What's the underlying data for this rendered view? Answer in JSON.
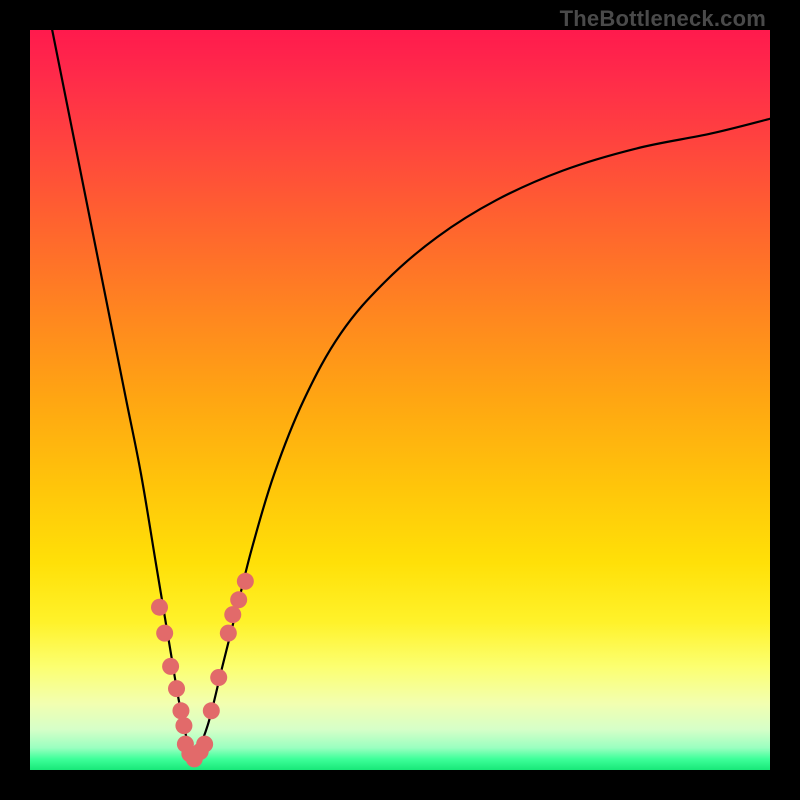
{
  "attribution": "TheBottleneck.com",
  "colors": {
    "frame": "#000000",
    "curve": "#000000",
    "marker": "#e26a6a",
    "gradient_top": "#ff1a4d",
    "gradient_mid": "#ffe008",
    "gradient_bottom": "#18e878"
  },
  "chart_data": {
    "type": "line",
    "title": "",
    "xlabel": "",
    "ylabel": "",
    "xlim": [
      0,
      100
    ],
    "ylim": [
      0,
      100
    ],
    "grid": false,
    "notes": "Bottleneck-style V-curve. x is an arbitrary component scale, y is percent bottleneck (0 = ideal, 100 = worst). Optimal point at x≈22. Values estimated from pixel positions.",
    "series": [
      {
        "name": "left_branch",
        "x": [
          3,
          5,
          7,
          9,
          11,
          13,
          15,
          17,
          18,
          19,
          20,
          21,
          22
        ],
        "y": [
          100,
          90,
          80,
          70,
          60,
          50,
          40,
          28,
          22,
          16,
          10,
          5,
          1
        ]
      },
      {
        "name": "right_branch",
        "x": [
          22,
          24,
          26,
          28,
          30,
          33,
          37,
          42,
          48,
          55,
          63,
          72,
          82,
          92,
          100
        ],
        "y": [
          1,
          6,
          14,
          22,
          30,
          40,
          50,
          59,
          66,
          72,
          77,
          81,
          84,
          86,
          88
        ]
      }
    ],
    "markers": {
      "name": "highlighted_points",
      "x": [
        17.5,
        18.2,
        19.0,
        19.8,
        20.4,
        20.8,
        21.0,
        21.6,
        22.2,
        23.0,
        23.6,
        24.5,
        25.5,
        26.8,
        27.4,
        28.2,
        29.1
      ],
      "y": [
        22,
        18.5,
        14,
        11,
        8,
        6,
        3.5,
        2.2,
        1.5,
        2.5,
        3.5,
        8,
        12.5,
        18.5,
        21,
        23,
        25.5
      ]
    }
  }
}
